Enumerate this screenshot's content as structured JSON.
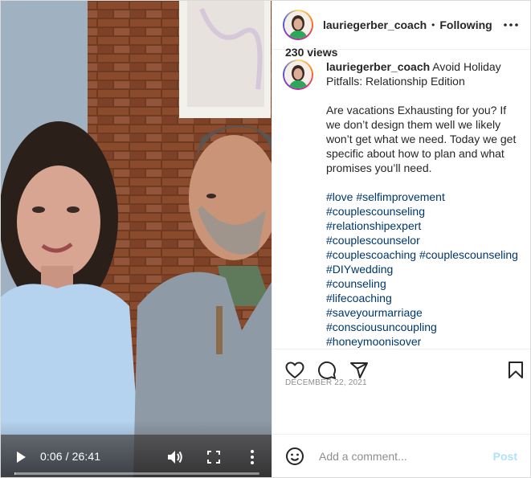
{
  "video": {
    "time": "0:06 / 26:41",
    "progress_fraction": 0.004,
    "icons": [
      "play-icon",
      "volume-icon",
      "fullscreen-icon",
      "more-vertical-icon"
    ]
  },
  "header": {
    "username": "lauriegerber_coach",
    "separator": "•",
    "follow_status": "Following"
  },
  "caption": {
    "username": "lauriegerber_coach",
    "title": "Avoid Holiday Pitfalls: Relationship Edition",
    "paragraph": "Are vacations Exhausting for you? If we don’t design them well we likely won’t get what we need. Today we get specific about how to plan and what promises you’ll need.",
    "hashtag_lines": [
      [
        "#love",
        "#selfimprovement"
      ],
      [
        "#couplescounseling"
      ],
      [
        "#relationshipexpert"
      ],
      [
        "#couplescounselor"
      ],
      [
        "#couplescoaching",
        "#couplescounseling"
      ],
      [
        "#DIYwedding"
      ],
      [
        "#counseling"
      ],
      [
        "#lifecoaching"
      ],
      [
        "#saveyourmarriage"
      ],
      [
        "#consciousuncoupling"
      ],
      [
        "#honeymoonisover"
      ]
    ]
  },
  "actions": {
    "icons": [
      "heart-icon",
      "comment-icon",
      "share-icon",
      "bookmark-icon"
    ]
  },
  "stats": {
    "views": "230 views",
    "date": "DECEMBER 22, 2021"
  },
  "comment": {
    "placeholder": "Add a comment...",
    "post_label": "Post"
  },
  "colors": {
    "link": "#00376b",
    "muted": "#8e8e8e",
    "post_disabled": "#b2dffc"
  }
}
